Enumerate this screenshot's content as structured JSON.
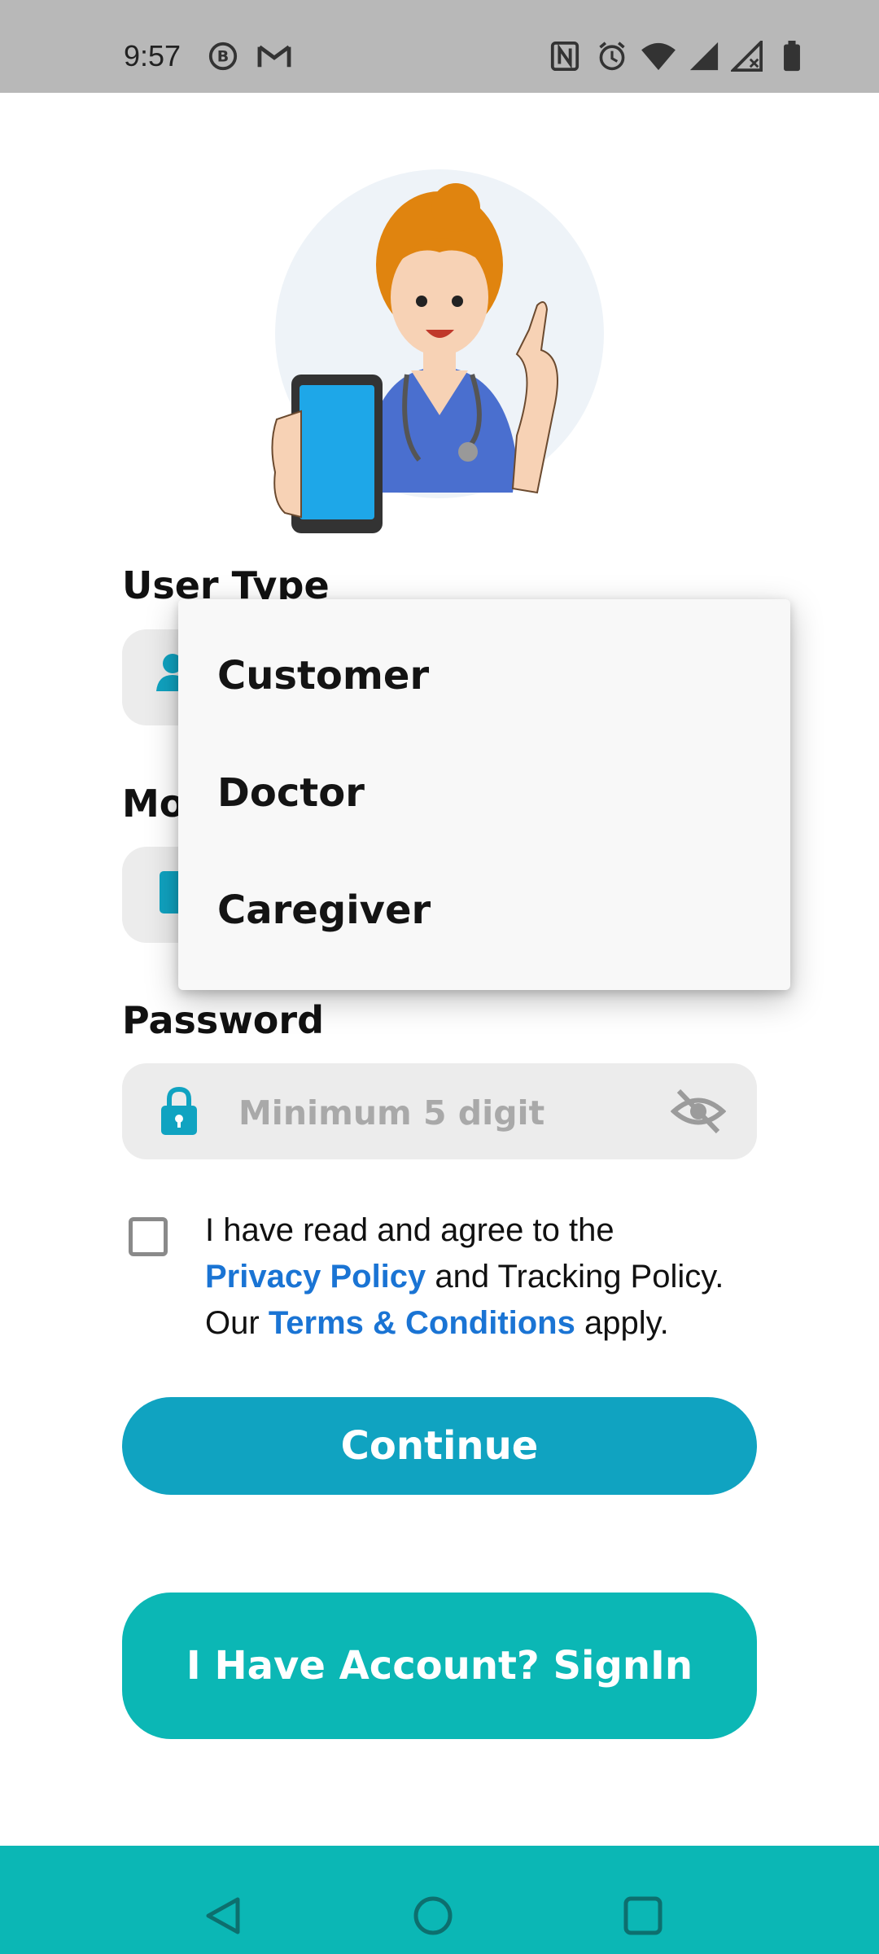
{
  "status_bar": {
    "time": "9:57"
  },
  "illustration": {
    "alt": "nurse holding phone"
  },
  "form": {
    "user_type": {
      "label": "User Type"
    },
    "mobile": {
      "label": "Mobile"
    },
    "password": {
      "label": "Password",
      "placeholder": "Minimum 5 digit"
    }
  },
  "dropdown": {
    "options": [
      "Customer",
      "Doctor",
      "Caregiver"
    ]
  },
  "agreement": {
    "text_1": "I have read and agree to the",
    "privacy_link": "Privacy Policy",
    "text_2": "and Tracking Policy.",
    "text_3": "Our",
    "terms_link": "Terms & Conditions",
    "text_4": "apply."
  },
  "buttons": {
    "continue": "Continue",
    "signin": "I Have Account? SignIn"
  },
  "colors": {
    "primary": "#10a3c1",
    "secondary": "#0bb7b5",
    "link": "#1a74d4"
  },
  "icons": {
    "user_field": "person-icon",
    "password_field": "lock-icon",
    "visibility": "eye-off-icon"
  }
}
